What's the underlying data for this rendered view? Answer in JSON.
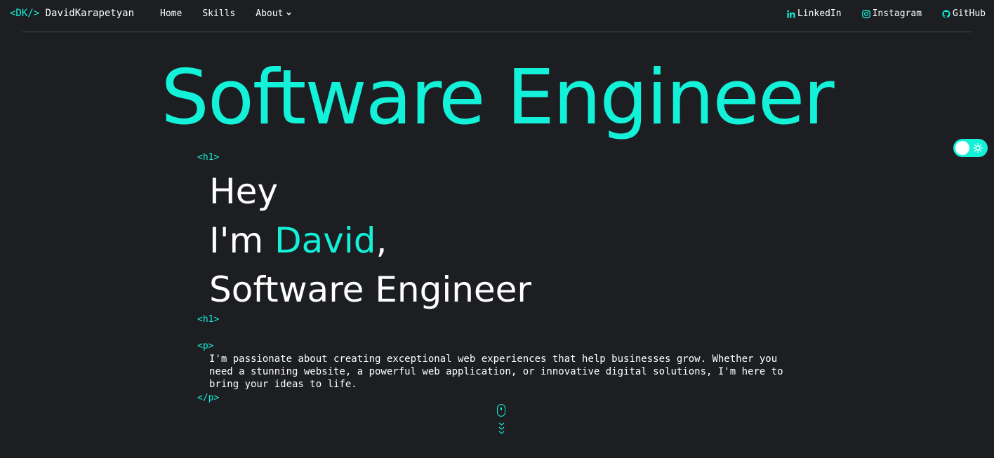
{
  "nav": {
    "logo_tag": "<DK/>",
    "logo_name": "DavidKarapetyan",
    "links": [
      {
        "label": "Home"
      },
      {
        "label": "Skills"
      },
      {
        "label": "About"
      }
    ],
    "social": [
      {
        "label": "LinkedIn",
        "icon": "linkedin-icon"
      },
      {
        "label": "Instagram",
        "icon": "instagram-icon"
      },
      {
        "label": "GitHub",
        "icon": "github-icon"
      }
    ]
  },
  "hero": {
    "title": "Software Engineer"
  },
  "intro": {
    "open_h1": "<h1>",
    "close_h1": "<h1>",
    "line1": "Hey",
    "line2_prefix": "I'm ",
    "line2_name": "David",
    "line2_suffix": ",",
    "line3": "Software Engineer",
    "open_p": "<p>",
    "close_p": "</p>",
    "paragraph": "I'm passionate about creating exceptional web experiences that help businesses grow. Whether you need a stunning website, a powerful web application, or innovative digital solutions, I'm here to bring your ideas to life."
  },
  "theme": {
    "accent": "#14f1d9",
    "background": "#1c1e22",
    "toggle_icon": "sun-icon"
  },
  "scroll": {
    "icon": "mouse-icon",
    "arrows_icon": "chevrons-down-icon"
  }
}
